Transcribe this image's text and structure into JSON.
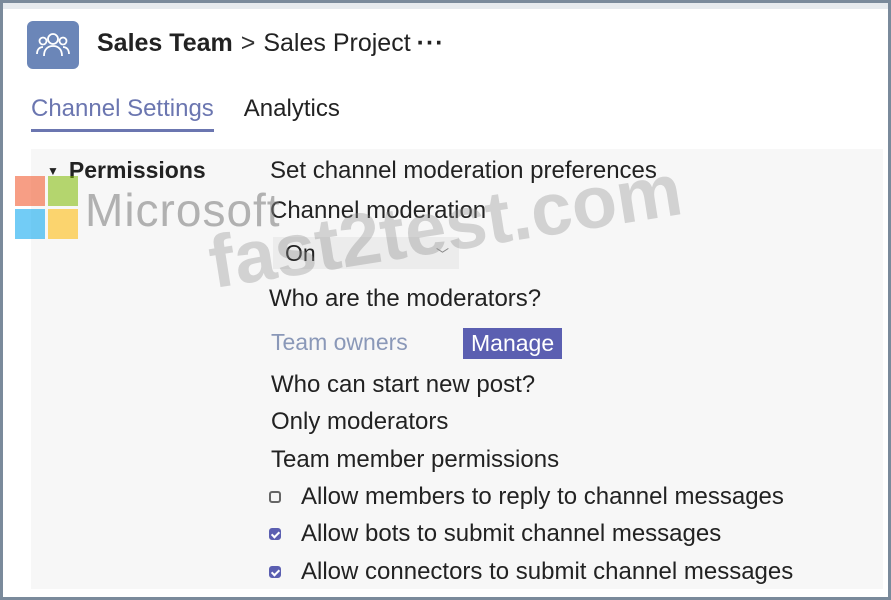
{
  "header": {
    "team_name": "Sales Team",
    "separator": ">",
    "channel_name": "Sales Project",
    "more": "···"
  },
  "tabs": [
    {
      "label": "Channel Settings",
      "active": true
    },
    {
      "label": "Analytics",
      "active": false
    }
  ],
  "section": {
    "label": "Permissions"
  },
  "settings": {
    "heading": "Set channel moderation preferences",
    "moderation_label": "Channel moderation",
    "moderation_value": "On",
    "moderators_question": "Who are the moderators?",
    "moderators_value": "Team owners",
    "manage_label": "Manage",
    "new_post_question": "Who can start new post?",
    "new_post_value": "Only moderators",
    "member_permissions_label": "Team member permissions",
    "checkboxes": [
      {
        "label": "Allow members to reply to channel messages",
        "checked": false
      },
      {
        "label": "Allow bots to submit channel messages",
        "checked": true
      },
      {
        "label": "Allow connectors to submit channel messages",
        "checked": true
      }
    ]
  },
  "watermarks": {
    "microsoft": "Microsoft",
    "site": "fast2test.com"
  },
  "colors": {
    "accent": "#5b5fb1",
    "tab_active": "#6b76b0",
    "avatar_bg": "#6b86b8",
    "panel_bg": "#f7f7f7"
  },
  "icons": {
    "team_avatar": "people-group-icon",
    "section_caret": "caret-down-icon",
    "dropdown_chevron": "chevron-down-icon"
  }
}
